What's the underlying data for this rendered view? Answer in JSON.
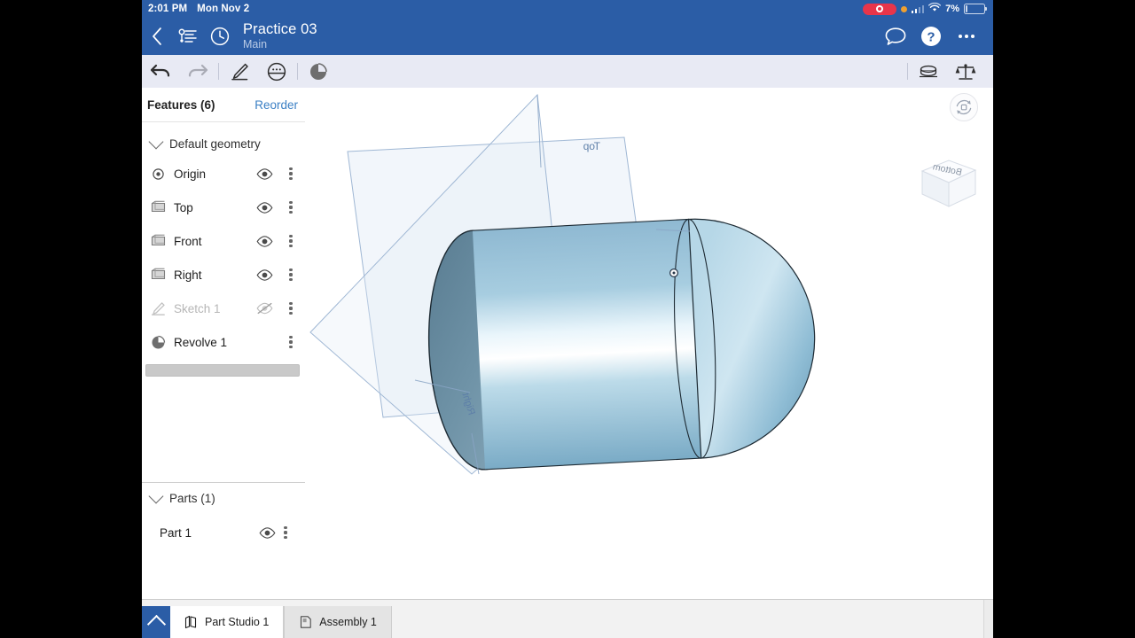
{
  "status_bar": {
    "time": "2:01 PM",
    "date": "Mon Nov 2",
    "battery_percent": "7%",
    "recording_icon": "screen-record-icon",
    "colors": {
      "bar": "#2b5da6",
      "record": "#e8354a",
      "orange_dot": "#f0a030"
    }
  },
  "header": {
    "back_icon": "back-chevron-icon",
    "versions_icon": "branch-versions-icon",
    "history_icon": "clock-history-icon",
    "title": "Practice 03",
    "subtitle": "Main",
    "comment_icon": "comment-bubble-icon",
    "help_icon": "help-question-icon",
    "overflow_icon": "more-options-icon"
  },
  "toolbar": {
    "undo_icon": "undo-arrow-icon",
    "redo_icon": "redo-arrow-icon",
    "sketch_icon": "sketch-pencil-icon",
    "extrude_icon": "extrude-icon",
    "revolve_icon": "revolve-icon",
    "measure_icon": "measure-icon",
    "mass_properties_icon": "mass-properties-scales-icon"
  },
  "panel": {
    "title": "Features (6)",
    "reorder_label": "Reorder",
    "group_label": "Default geometry",
    "features": [
      {
        "label": "Origin",
        "icon": "origin-icon",
        "visible": true,
        "dimmed": false,
        "has_eye": true
      },
      {
        "label": "Top",
        "icon": "plane-icon",
        "visible": true,
        "dimmed": false,
        "has_eye": true
      },
      {
        "label": "Front",
        "icon": "plane-icon",
        "visible": true,
        "dimmed": false,
        "has_eye": true
      },
      {
        "label": "Right",
        "icon": "plane-icon",
        "visible": true,
        "dimmed": false,
        "has_eye": true
      },
      {
        "label": "Sketch 1",
        "icon": "sketch-icon",
        "visible": false,
        "dimmed": true,
        "has_eye": true
      },
      {
        "label": "Revolve 1",
        "icon": "revolve-icon",
        "visible": true,
        "dimmed": false,
        "has_eye": false
      }
    ],
    "rollback_bar": "feature-rollback-bar",
    "parts_title": "Parts (1)",
    "parts": [
      {
        "label": "Part 1",
        "visible": true
      }
    ],
    "link_color": "#3a7fc4"
  },
  "canvas": {
    "orbit_icon": "orbit-rotate-icon",
    "view_cube_face": "Bottom",
    "plane_labels": {
      "top": "Top",
      "right": "Right"
    },
    "origin_marker": "origin-point-marker",
    "part_color": "#8fc0d8"
  },
  "tab_bar": {
    "collapse_icon": "collapse-up-chevron-icon",
    "tabs": [
      {
        "label": "Part Studio 1",
        "icon": "part-studio-icon",
        "active": true
      },
      {
        "label": "Assembly 1",
        "icon": "assembly-icon",
        "active": false
      }
    ]
  }
}
